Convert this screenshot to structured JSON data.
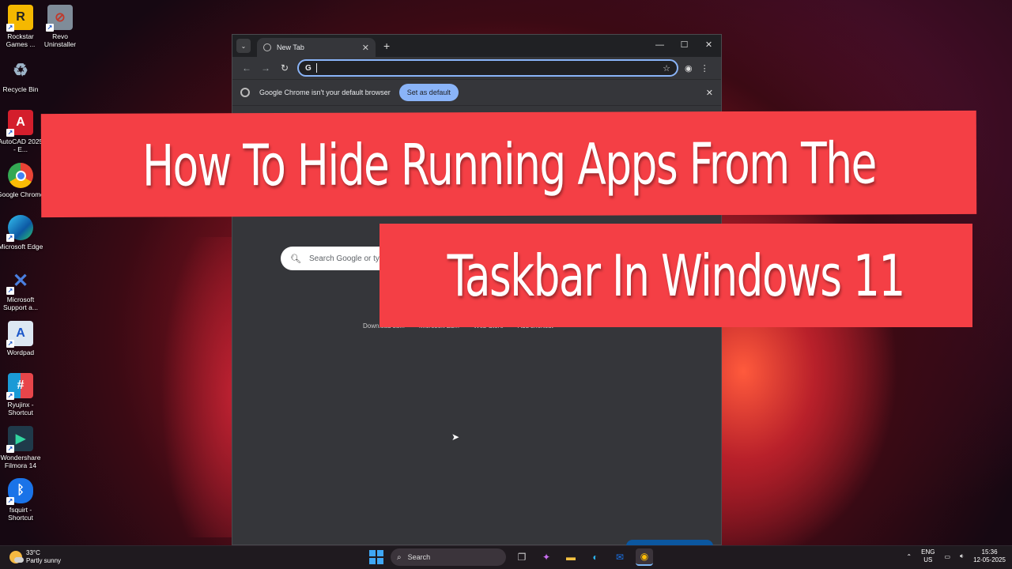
{
  "desktop": {
    "icons": [
      {
        "label": "Rockstar Games ...",
        "icon": "rockstar-icon",
        "color": "#f5b800",
        "glyph": "R"
      },
      {
        "label": "Revo Uninstaller",
        "icon": "revo-uninstaller-icon",
        "color": "#c0392b",
        "glyph": "⊘"
      },
      {
        "label": "Recycle Bin",
        "icon": "recycle-bin-icon",
        "color": "#9db4c8",
        "glyph": "🗑"
      },
      {
        "label": "AutoCAD 2025 - E...",
        "icon": "autocad-icon",
        "color": "#d41e2c",
        "glyph": "A"
      },
      {
        "label": "Google Chrome",
        "icon": "chrome-icon",
        "color": "#ffffff",
        "glyph": "◉"
      },
      {
        "label": "Microsoft Edge",
        "icon": "edge-icon",
        "color": "#1f8fd6",
        "glyph": "e"
      },
      {
        "label": "Microsoft Support a...",
        "icon": "microsoft-support-icon",
        "color": "#2f6fd3",
        "glyph": "✕"
      },
      {
        "label": "Wordpad",
        "icon": "wordpad-icon",
        "color": "#dce7f2",
        "glyph": "A"
      },
      {
        "label": "Ryujinx - Shortcut",
        "icon": "ryujinx-icon",
        "color": "#1a8fd6",
        "glyph": "#"
      },
      {
        "label": "Wondershare Filmora 14",
        "icon": "filmora-icon",
        "color": "#1fa58a",
        "glyph": "▶"
      },
      {
        "label": "fsquirt - Shortcut",
        "icon": "bluetooth-icon",
        "color": "#1a73e8",
        "glyph": "ᛒ"
      }
    ]
  },
  "browser": {
    "tab_title": "New Tab",
    "infobar_text": "Google Chrome isn't your default browser",
    "set_default_label": "Set as default",
    "search_placeholder": "Search Google or ty",
    "shortcuts": [
      "Download su...",
      "Microsoft Ed...",
      "Web Store",
      "Add shortcut"
    ]
  },
  "overlay": {
    "line1": "How To Hide Running Apps From The",
    "line2": "Taskbar In Windows 11",
    "banner_color": "#f43f45"
  },
  "taskbar": {
    "weather_temp": "33°C",
    "weather_desc": "Partly sunny",
    "search_label": "Search",
    "lang_top": "ENG",
    "lang_bottom": "US",
    "time": "15:36",
    "date": "12-05-2025"
  }
}
